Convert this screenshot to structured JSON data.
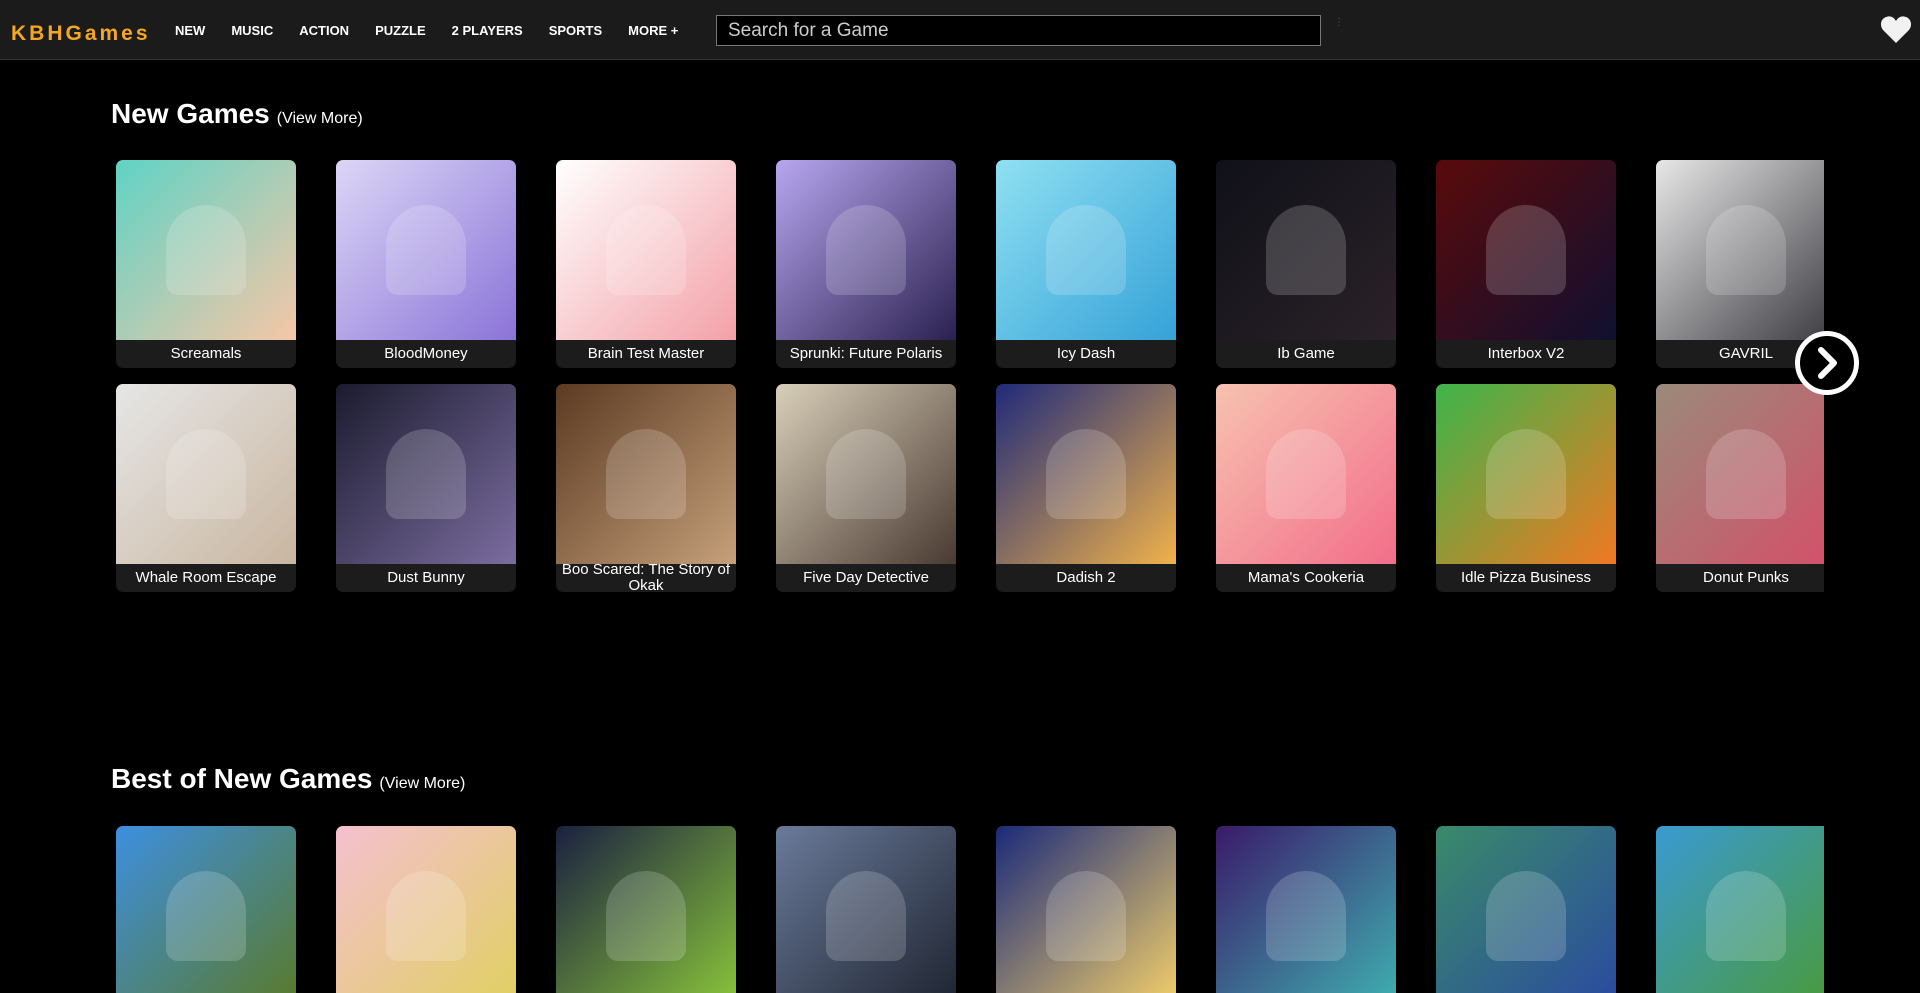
{
  "header": {
    "logo": "KBHGames",
    "nav": [
      "NEW",
      "MUSIC",
      "ACTION",
      "PUZZLE",
      "2 PLAYERS",
      "SPORTS",
      "MORE +"
    ],
    "search_placeholder": "Search for a Game"
  },
  "sections": [
    {
      "title": "New Games",
      "view_more": "(View More)",
      "rows": [
        [
          {
            "name": "Screamals",
            "c1": "#5fd3c5",
            "c2": "#f6c6a6"
          },
          {
            "name": "BloodMoney",
            "c1": "#dcd6f6",
            "c2": "#8a74d8"
          },
          {
            "name": "Brain Test Master",
            "c1": "#ffffff",
            "c2": "#f3a1a8"
          },
          {
            "name": "Sprunki: Future Polaris",
            "c1": "#b7a6f0",
            "c2": "#2b2150"
          },
          {
            "name": "Icy Dash",
            "c1": "#8fe0f2",
            "c2": "#35a2d8"
          },
          {
            "name": "Ib Game",
            "c1": "#101018",
            "c2": "#2a2228"
          },
          {
            "name": "Interbox V2",
            "c1": "#5a0a0a",
            "c2": "#101030"
          },
          {
            "name": "GAVRIL",
            "c1": "#e7e7e7",
            "c2": "#3a3a40"
          }
        ],
        [
          {
            "name": "Whale Room Escape",
            "c1": "#e6e6e6",
            "c2": "#c9b6a0"
          },
          {
            "name": "Dust Bunny",
            "c1": "#1b1b2e",
            "c2": "#7b6da0"
          },
          {
            "name": "Boo Scared: The Story of Okak",
            "c1": "#5b3a22",
            "c2": "#c6a07a"
          },
          {
            "name": "Five Day Detective",
            "c1": "#d8cfb9",
            "c2": "#4a3a32"
          },
          {
            "name": "Dadish 2",
            "c1": "#1f2a7a",
            "c2": "#f0b24a"
          },
          {
            "name": "Mama's Cookeria",
            "c1": "#f7c2b0",
            "c2": "#f26e8a"
          },
          {
            "name": "Idle Pizza Business",
            "c1": "#3db54a",
            "c2": "#f07822"
          },
          {
            "name": "Donut Punks",
            "c1": "#9a8a7a",
            "c2": "#d4506a"
          }
        ]
      ]
    },
    {
      "title": "Best of New Games",
      "view_more": "(View More)",
      "rows": [
        [
          {
            "name": "",
            "c1": "#3d8fe0",
            "c2": "#5a7a2a"
          },
          {
            "name": "",
            "c1": "#f5c0d0",
            "c2": "#e0d060"
          },
          {
            "name": "",
            "c1": "#1a2040",
            "c2": "#8ac53a"
          },
          {
            "name": "",
            "c1": "#6a7a9a",
            "c2": "#1e2430"
          },
          {
            "name": "",
            "c1": "#1a2a7a",
            "c2": "#f4d06a"
          },
          {
            "name": "",
            "c1": "#3a1a6a",
            "c2": "#3fb0b0"
          },
          {
            "name": "",
            "c1": "#3a8a6a",
            "c2": "#2a4aa0"
          },
          {
            "name": "",
            "c1": "#3a9ad0",
            "c2": "#4a9a3a"
          }
        ]
      ]
    }
  ]
}
